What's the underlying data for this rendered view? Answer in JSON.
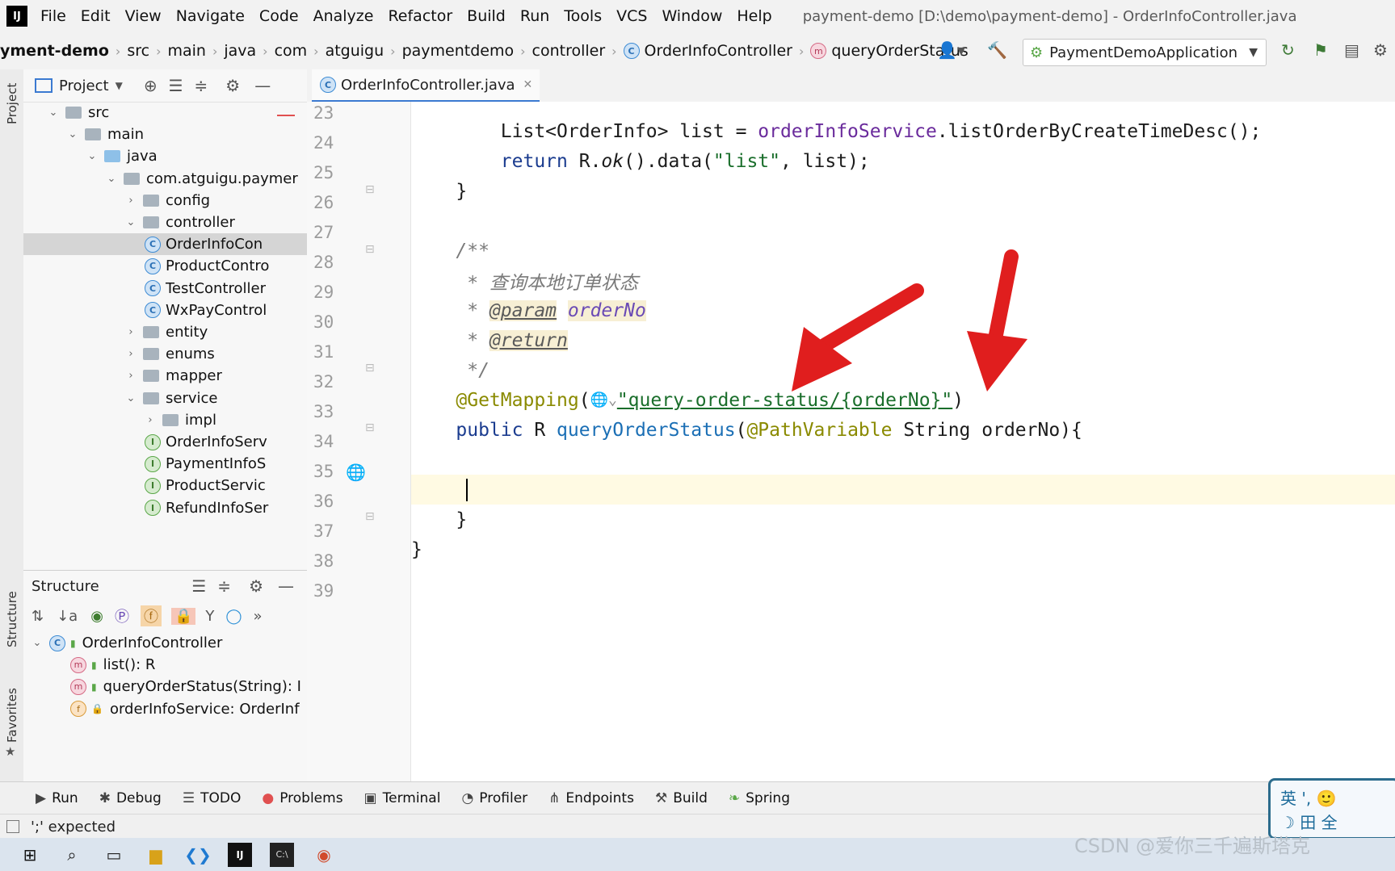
{
  "menubar": {
    "logo": "IJ",
    "items": [
      "File",
      "Edit",
      "View",
      "Navigate",
      "Code",
      "Analyze",
      "Refactor",
      "Build",
      "Run",
      "Tools",
      "VCS",
      "Window",
      "Help"
    ],
    "window_title": "payment-demo [D:\\demo\\payment-demo] - OrderInfoController.java"
  },
  "navbar": {
    "breadcrumbs": [
      "yment-demo",
      "src",
      "main",
      "java",
      "com",
      "atguigu",
      "paymentdemo",
      "controller",
      "OrderInfoController",
      "queryOrderStatus"
    ],
    "run_config": "PaymentDemoApplication"
  },
  "project_panel": {
    "title": "Project",
    "tree": [
      {
        "label": "src",
        "arrow": "v",
        "kind": "folder",
        "indent": 0
      },
      {
        "label": "main",
        "arrow": "v",
        "kind": "folder",
        "indent": 1
      },
      {
        "label": "java",
        "arrow": "v",
        "kind": "folder-blue",
        "indent": 2
      },
      {
        "label": "com.atguigu.paymer",
        "arrow": "v",
        "kind": "folder",
        "indent": 3
      },
      {
        "label": "config",
        "arrow": ">",
        "kind": "folder",
        "indent": 4
      },
      {
        "label": "controller",
        "arrow": "v",
        "kind": "folder",
        "indent": 4
      },
      {
        "label": "OrderInfoCon",
        "arrow": "",
        "kind": "class",
        "indent": 5,
        "selected": true
      },
      {
        "label": "ProductContro",
        "arrow": "",
        "kind": "class",
        "indent": 5
      },
      {
        "label": "TestController",
        "arrow": "",
        "kind": "class",
        "indent": 5
      },
      {
        "label": "WxPayControl",
        "arrow": "",
        "kind": "class",
        "indent": 5
      },
      {
        "label": "entity",
        "arrow": ">",
        "kind": "folder",
        "indent": 4
      },
      {
        "label": "enums",
        "arrow": ">",
        "kind": "folder",
        "indent": 4
      },
      {
        "label": "mapper",
        "arrow": ">",
        "kind": "folder",
        "indent": 4
      },
      {
        "label": "service",
        "arrow": "v",
        "kind": "folder",
        "indent": 4
      },
      {
        "label": "impl",
        "arrow": ">",
        "kind": "folder",
        "indent": 5
      },
      {
        "label": "OrderInfoServ",
        "arrow": "",
        "kind": "interface",
        "indent": 5
      },
      {
        "label": "PaymentInfoS",
        "arrow": "",
        "kind": "interface",
        "indent": 5
      },
      {
        "label": "ProductServic",
        "arrow": "",
        "kind": "interface",
        "indent": 5
      },
      {
        "label": "RefundInfoSer",
        "arrow": "",
        "kind": "interface",
        "indent": 5
      }
    ]
  },
  "structure_panel": {
    "title": "Structure",
    "items": [
      {
        "label": "OrderInfoController",
        "badge": "c",
        "indent": 0
      },
      {
        "label": "list(): R",
        "badge": "m",
        "indent": 1
      },
      {
        "label": "queryOrderStatus(String): I",
        "badge": "m",
        "indent": 1
      },
      {
        "label": "orderInfoService: OrderInf",
        "badge": "f",
        "indent": 1
      }
    ]
  },
  "left_strip": {
    "project": "Project",
    "structure": "Structure",
    "favorites": "Favorites"
  },
  "editor": {
    "tab": "OrderInfoController.java",
    "line_numbers": [
      "23",
      "24",
      "25",
      "26",
      "27",
      "28",
      "29",
      "30",
      "31",
      "32",
      "33",
      "34",
      "35",
      "36",
      "37",
      "38",
      "39"
    ],
    "line24": {
      "a": "        List<OrderInfo> list = ",
      "b": "orderInfoService",
      "c": ".listOrderByCreateTimeDesc();"
    },
    "line25": {
      "a": "        ",
      "kw": "return",
      " b": " R.",
      "ok": "ok",
      "c": "().data(",
      "s": "\"list\"",
      "d": ", list);"
    },
    "line26": "    }",
    "line28": "    /**",
    "line29": "     * 查询本地订单状态",
    "line30": {
      "a": "     * ",
      "tag": "@param",
      "b": " ",
      "p": "orderNo"
    },
    "line31": {
      "a": "     * ",
      "tag": "@return"
    },
    "line32": "     */",
    "line33": {
      "ann": "    @GetMapping",
      "a": "(",
      "icon": "🌐⌄",
      "s": "\"query-order-status/{orderNo}\"",
      "b": ")"
    },
    "line34": {
      "kw": "    public",
      " b": " R ",
      "fn": "queryOrderStatus",
      "c": "(",
      "ann": "@PathVariable",
      "d": " String orderNo){"
    },
    "line37": "    }",
    "line38": "}"
  },
  "bottom_tools": [
    "Run",
    "Debug",
    "TODO",
    "Problems",
    "Terminal",
    "Profiler",
    "Endpoints",
    "Build",
    "Spring"
  ],
  "status_text": "';' expected",
  "ime": {
    "top": "英 ', 🙂",
    "bottom": "☽ 田 全"
  },
  "watermark": "CSDN @爱你三千遍斯塔克"
}
